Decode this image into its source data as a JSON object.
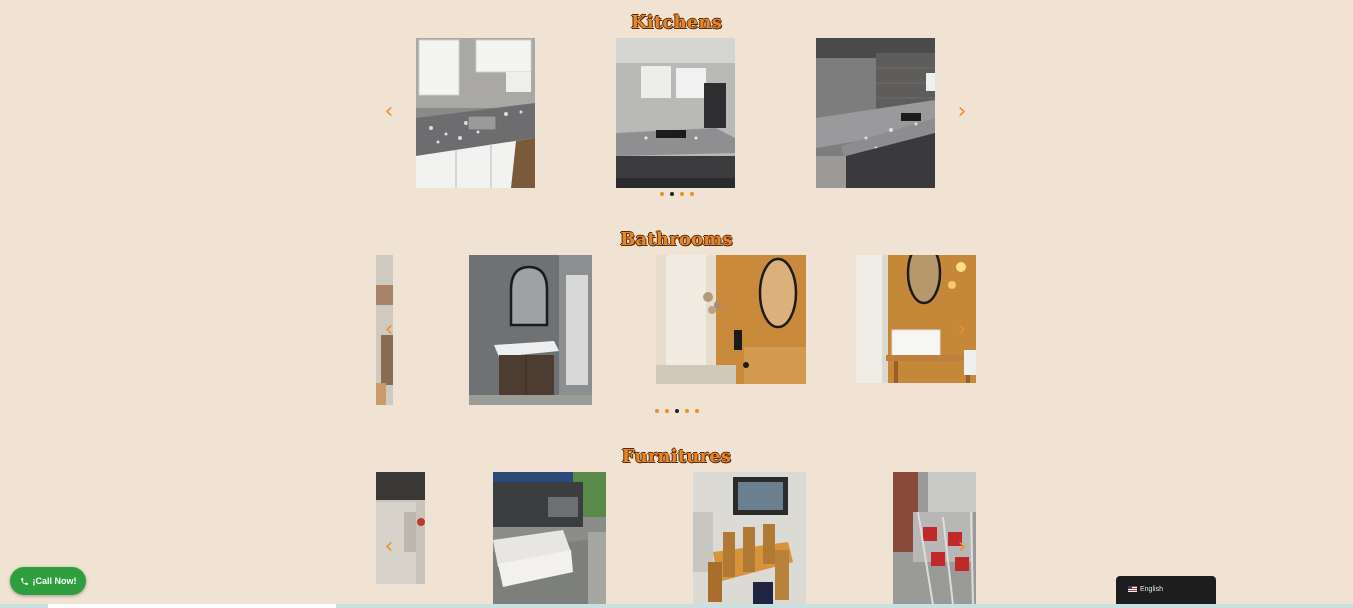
{
  "sections": {
    "kitchens": {
      "title": "Kitchens"
    },
    "bathrooms": {
      "title": "Bathrooms"
    },
    "furnitures": {
      "title": "Furnitures"
    }
  },
  "arrows": {
    "prev": "‹",
    "next": "›"
  },
  "call_button": {
    "label": "¡Call Now!",
    "icon": "phone-icon"
  },
  "language_switcher": {
    "label": "English",
    "flag": "us-flag-icon"
  },
  "colors": {
    "background": "#f1e3d3",
    "accent": "#e8912a",
    "title_outline": "#5a2a08",
    "call_green": "#2e9e3e",
    "active_dot": "#222222"
  }
}
